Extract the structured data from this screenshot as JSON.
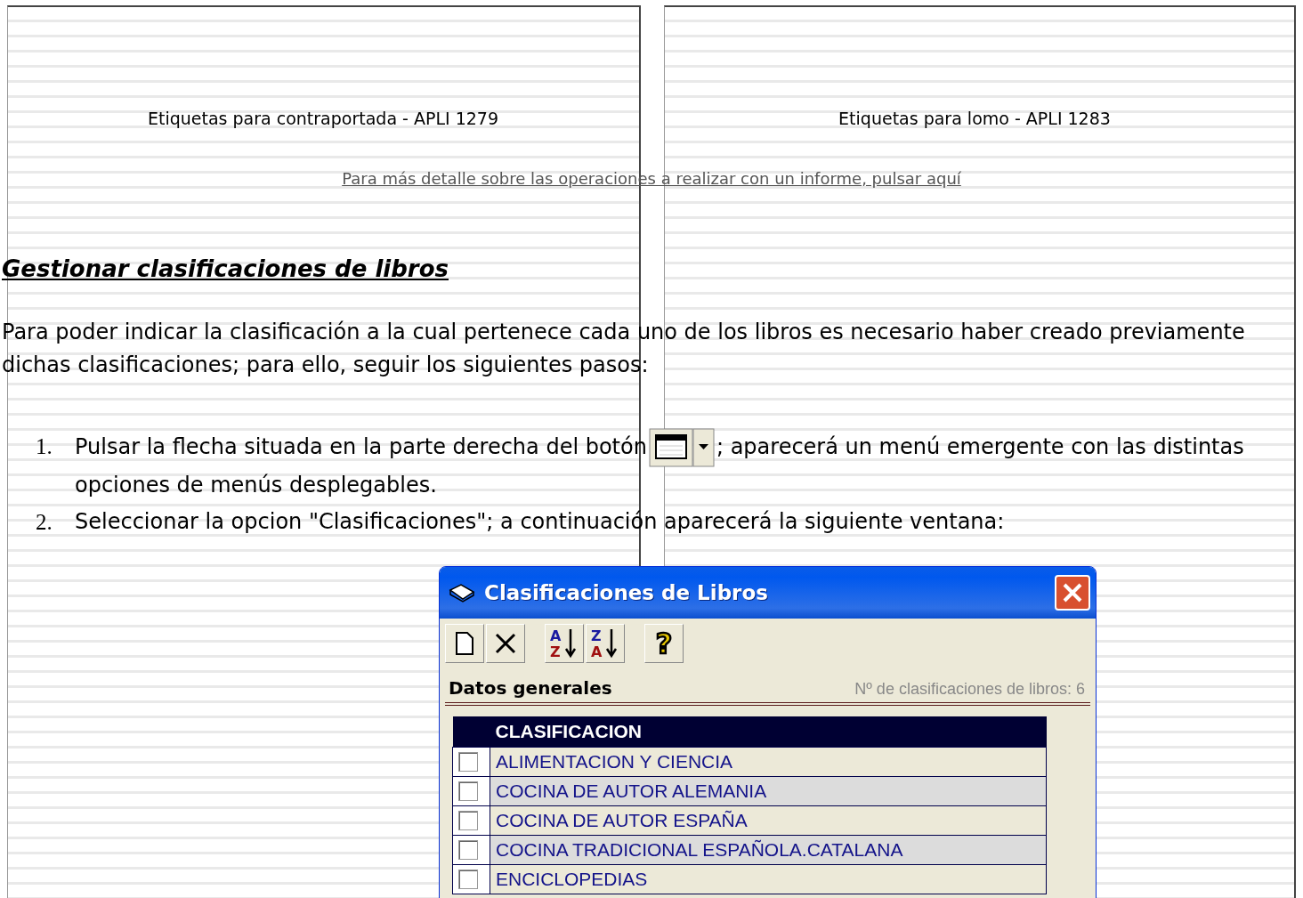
{
  "background_pages": [
    {
      "caption": "Etiquetas para contraportada - APLI 1279"
    },
    {
      "caption": "Etiquetas para lomo - APLI 1283"
    }
  ],
  "detail_link": "Para más detalle sobre las operaciones a realizar con un informe, pulsar aquí",
  "heading": "Gestionar clasificaciones de libros",
  "intro": "Para poder indicar la clasificación a la cual pertenece cada uno de los libros es necesario haber creado previamente dichas clasificaciones; para ello, seguir los siguientes pasos:",
  "steps": [
    {
      "kind": "with_button",
      "number": "1.",
      "text_before": "Pulsar la flecha situada en la parte derecha del botón",
      "text_after": "; aparecerá un menú emergente con las distintas",
      "text_continued": "opciones de menús desplegables."
    },
    {
      "kind": "plain",
      "number": "2.",
      "text": "Seleccionar la opcion \"Clasificaciones\"; a continuación aparecerá la siguiente ventana:"
    }
  ],
  "dialog": {
    "title": "Clasificaciones de Libros",
    "toolbar": [
      {
        "kind": "new"
      },
      {
        "kind": "delete"
      },
      {
        "kind": "sort",
        "glyphs": [
          "A",
          "Z"
        ]
      },
      {
        "kind": "sort",
        "glyphs": [
          "Z",
          "A"
        ]
      },
      {
        "kind": "help",
        "glyphs": [
          "?"
        ]
      }
    ],
    "section_title": "Datos generales",
    "count": "Nº de clasificaciones de libros: 6",
    "table": {
      "columns": [
        "CLASIFICACION"
      ],
      "rows": [
        {
          "name": "ALIMENTACION Y CIENCIA",
          "checked": false
        },
        {
          "name": "COCINA DE AUTOR ALEMANIA",
          "checked": false
        },
        {
          "name": "COCINA DE AUTOR ESPAÑA",
          "checked": false
        },
        {
          "name": "COCINA TRADICIONAL ESPAÑOLA.CATALANA",
          "checked": false
        },
        {
          "name": "ENCICLOPEDIAS",
          "checked": false
        }
      ]
    }
  }
}
